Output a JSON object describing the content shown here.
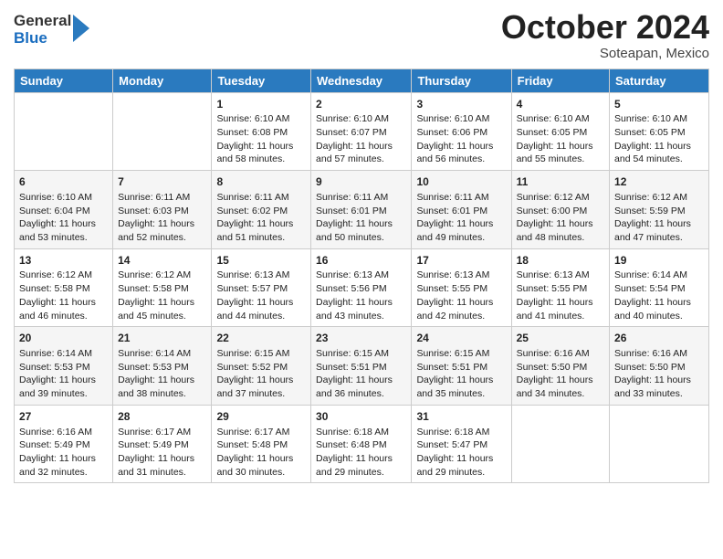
{
  "header": {
    "logo": {
      "general": "General",
      "blue": "Blue"
    },
    "title": "October 2024",
    "location": "Soteapan, Mexico"
  },
  "weekdays": [
    "Sunday",
    "Monday",
    "Tuesday",
    "Wednesday",
    "Thursday",
    "Friday",
    "Saturday"
  ],
  "weeks": [
    [
      {
        "day": "",
        "sunrise": "",
        "sunset": "",
        "daylight": ""
      },
      {
        "day": "",
        "sunrise": "",
        "sunset": "",
        "daylight": ""
      },
      {
        "day": "1",
        "sunrise": "Sunrise: 6:10 AM",
        "sunset": "Sunset: 6:08 PM",
        "daylight": "Daylight: 11 hours and 58 minutes."
      },
      {
        "day": "2",
        "sunrise": "Sunrise: 6:10 AM",
        "sunset": "Sunset: 6:07 PM",
        "daylight": "Daylight: 11 hours and 57 minutes."
      },
      {
        "day": "3",
        "sunrise": "Sunrise: 6:10 AM",
        "sunset": "Sunset: 6:06 PM",
        "daylight": "Daylight: 11 hours and 56 minutes."
      },
      {
        "day": "4",
        "sunrise": "Sunrise: 6:10 AM",
        "sunset": "Sunset: 6:05 PM",
        "daylight": "Daylight: 11 hours and 55 minutes."
      },
      {
        "day": "5",
        "sunrise": "Sunrise: 6:10 AM",
        "sunset": "Sunset: 6:05 PM",
        "daylight": "Daylight: 11 hours and 54 minutes."
      }
    ],
    [
      {
        "day": "6",
        "sunrise": "Sunrise: 6:10 AM",
        "sunset": "Sunset: 6:04 PM",
        "daylight": "Daylight: 11 hours and 53 minutes."
      },
      {
        "day": "7",
        "sunrise": "Sunrise: 6:11 AM",
        "sunset": "Sunset: 6:03 PM",
        "daylight": "Daylight: 11 hours and 52 minutes."
      },
      {
        "day": "8",
        "sunrise": "Sunrise: 6:11 AM",
        "sunset": "Sunset: 6:02 PM",
        "daylight": "Daylight: 11 hours and 51 minutes."
      },
      {
        "day": "9",
        "sunrise": "Sunrise: 6:11 AM",
        "sunset": "Sunset: 6:01 PM",
        "daylight": "Daylight: 11 hours and 50 minutes."
      },
      {
        "day": "10",
        "sunrise": "Sunrise: 6:11 AM",
        "sunset": "Sunset: 6:01 PM",
        "daylight": "Daylight: 11 hours and 49 minutes."
      },
      {
        "day": "11",
        "sunrise": "Sunrise: 6:12 AM",
        "sunset": "Sunset: 6:00 PM",
        "daylight": "Daylight: 11 hours and 48 minutes."
      },
      {
        "day": "12",
        "sunrise": "Sunrise: 6:12 AM",
        "sunset": "Sunset: 5:59 PM",
        "daylight": "Daylight: 11 hours and 47 minutes."
      }
    ],
    [
      {
        "day": "13",
        "sunrise": "Sunrise: 6:12 AM",
        "sunset": "Sunset: 5:58 PM",
        "daylight": "Daylight: 11 hours and 46 minutes."
      },
      {
        "day": "14",
        "sunrise": "Sunrise: 6:12 AM",
        "sunset": "Sunset: 5:58 PM",
        "daylight": "Daylight: 11 hours and 45 minutes."
      },
      {
        "day": "15",
        "sunrise": "Sunrise: 6:13 AM",
        "sunset": "Sunset: 5:57 PM",
        "daylight": "Daylight: 11 hours and 44 minutes."
      },
      {
        "day": "16",
        "sunrise": "Sunrise: 6:13 AM",
        "sunset": "Sunset: 5:56 PM",
        "daylight": "Daylight: 11 hours and 43 minutes."
      },
      {
        "day": "17",
        "sunrise": "Sunrise: 6:13 AM",
        "sunset": "Sunset: 5:55 PM",
        "daylight": "Daylight: 11 hours and 42 minutes."
      },
      {
        "day": "18",
        "sunrise": "Sunrise: 6:13 AM",
        "sunset": "Sunset: 5:55 PM",
        "daylight": "Daylight: 11 hours and 41 minutes."
      },
      {
        "day": "19",
        "sunrise": "Sunrise: 6:14 AM",
        "sunset": "Sunset: 5:54 PM",
        "daylight": "Daylight: 11 hours and 40 minutes."
      }
    ],
    [
      {
        "day": "20",
        "sunrise": "Sunrise: 6:14 AM",
        "sunset": "Sunset: 5:53 PM",
        "daylight": "Daylight: 11 hours and 39 minutes."
      },
      {
        "day": "21",
        "sunrise": "Sunrise: 6:14 AM",
        "sunset": "Sunset: 5:53 PM",
        "daylight": "Daylight: 11 hours and 38 minutes."
      },
      {
        "day": "22",
        "sunrise": "Sunrise: 6:15 AM",
        "sunset": "Sunset: 5:52 PM",
        "daylight": "Daylight: 11 hours and 37 minutes."
      },
      {
        "day": "23",
        "sunrise": "Sunrise: 6:15 AM",
        "sunset": "Sunset: 5:51 PM",
        "daylight": "Daylight: 11 hours and 36 minutes."
      },
      {
        "day": "24",
        "sunrise": "Sunrise: 6:15 AM",
        "sunset": "Sunset: 5:51 PM",
        "daylight": "Daylight: 11 hours and 35 minutes."
      },
      {
        "day": "25",
        "sunrise": "Sunrise: 6:16 AM",
        "sunset": "Sunset: 5:50 PM",
        "daylight": "Daylight: 11 hours and 34 minutes."
      },
      {
        "day": "26",
        "sunrise": "Sunrise: 6:16 AM",
        "sunset": "Sunset: 5:50 PM",
        "daylight": "Daylight: 11 hours and 33 minutes."
      }
    ],
    [
      {
        "day": "27",
        "sunrise": "Sunrise: 6:16 AM",
        "sunset": "Sunset: 5:49 PM",
        "daylight": "Daylight: 11 hours and 32 minutes."
      },
      {
        "day": "28",
        "sunrise": "Sunrise: 6:17 AM",
        "sunset": "Sunset: 5:49 PM",
        "daylight": "Daylight: 11 hours and 31 minutes."
      },
      {
        "day": "29",
        "sunrise": "Sunrise: 6:17 AM",
        "sunset": "Sunset: 5:48 PM",
        "daylight": "Daylight: 11 hours and 30 minutes."
      },
      {
        "day": "30",
        "sunrise": "Sunrise: 6:18 AM",
        "sunset": "Sunset: 6:48 PM",
        "daylight": "Daylight: 11 hours and 29 minutes."
      },
      {
        "day": "31",
        "sunrise": "Sunrise: 6:18 AM",
        "sunset": "Sunset: 5:47 PM",
        "daylight": "Daylight: 11 hours and 29 minutes."
      },
      {
        "day": "",
        "sunrise": "",
        "sunset": "",
        "daylight": ""
      },
      {
        "day": "",
        "sunrise": "",
        "sunset": "",
        "daylight": ""
      }
    ]
  ]
}
